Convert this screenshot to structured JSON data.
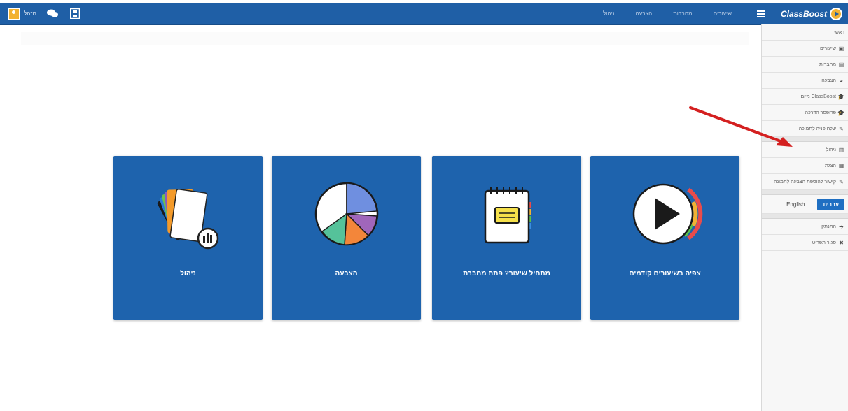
{
  "topbar": {
    "brand": "ClassBoost",
    "user_name": "מנהל",
    "nav": [
      "שיעורים",
      "מחברות",
      "הצבעה",
      "ניהול"
    ]
  },
  "sidebar": {
    "items": [
      {
        "label": "ראשי",
        "icon": "none"
      },
      {
        "label": "שיעורים",
        "icon": "film-icon"
      },
      {
        "label": "מחברות",
        "icon": "notebook-icon"
      },
      {
        "label": "הצבעה",
        "icon": "pie-chart-icon"
      },
      {
        "label": "ClassBoost מיום",
        "icon": "graduation-cap-icon"
      },
      {
        "label": "פרופסר הדרכה",
        "icon": "graduation-cap-icon"
      },
      {
        "label": "שלח פניה לתמיכה",
        "icon": "edit-icon"
      }
    ],
    "items2": [
      {
        "label": "ניהול",
        "icon": "bar-chart-icon"
      },
      {
        "label": "הצגת",
        "icon": "table-icon"
      },
      {
        "label": "קישור להוספת הצבעה לתמונה",
        "icon": "link-icon"
      }
    ],
    "lang_hebrew": "עברית",
    "lang_english": "English",
    "items3": [
      {
        "label": "התנתק",
        "icon": "logout-icon"
      },
      {
        "label": "סגור תפריט",
        "icon": "close-icon"
      }
    ]
  },
  "cards": [
    {
      "label": "ניהול",
      "icon": "management-cards-icon"
    },
    {
      "label": "הצבעה",
      "icon": "pie-chart-icon"
    },
    {
      "label": "מתחיל שיעור? פתח מחברת",
      "icon": "notebook-icon"
    },
    {
      "label": "צפיה בשיעורים קודמים",
      "icon": "play-icon"
    }
  ],
  "colors": {
    "primary": "#1e63ad",
    "topbar": "#1f5fa6",
    "accent": "#f2b233",
    "arrow": "#d42020"
  }
}
